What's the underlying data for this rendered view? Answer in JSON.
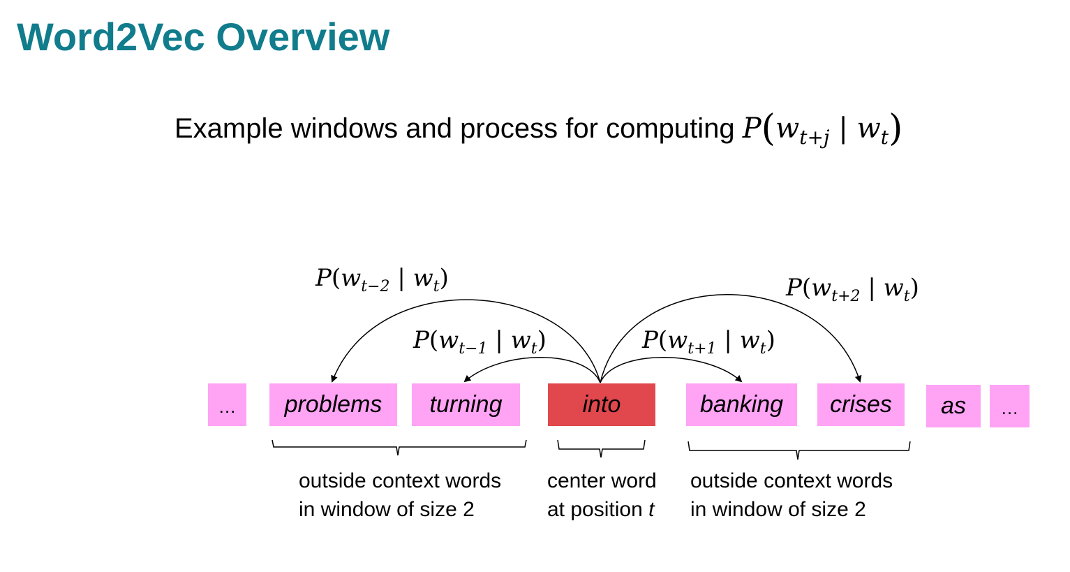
{
  "title": "Word2Vec Overview",
  "subtitle": {
    "text": "Example windows and process for computing",
    "formula_P": "P",
    "formula_w1": "w",
    "formula_sub1": "t+j",
    "formula_bar": "|",
    "formula_w2": "w",
    "formula_sub2": "t"
  },
  "words": [
    "…",
    "problems",
    "turning",
    "into",
    "banking",
    "crises",
    "as",
    "…"
  ],
  "prob_labels": {
    "t_minus_2": {
      "P": "P",
      "w": "w",
      "sub": "t−2",
      "bar": "|",
      "w2": "w",
      "sub2": "t"
    },
    "t_minus_1": {
      "P": "P",
      "w": "w",
      "sub": "t−1",
      "bar": "|",
      "w2": "w",
      "sub2": "t"
    },
    "t_plus_1": {
      "P": "P",
      "w": "w",
      "sub": "t+1",
      "bar": "|",
      "w2": "w",
      "sub2": "t"
    },
    "t_plus_2": {
      "P": "P",
      "w": "w",
      "sub": "t+2",
      "bar": "|",
      "w2": "w",
      "sub2": "t"
    }
  },
  "captions": {
    "left": {
      "line1": "outside context words",
      "line2": "in window of size 2"
    },
    "center": {
      "line1": "center word",
      "line2_prefix": "at position ",
      "line2_var": "t"
    },
    "right": {
      "line1": "outside context words",
      "line2": "in window of size 2"
    }
  },
  "colors": {
    "title": "#107C8C",
    "context_word_bg": "#FFA3F5",
    "center_word_bg": "#E0484D"
  }
}
